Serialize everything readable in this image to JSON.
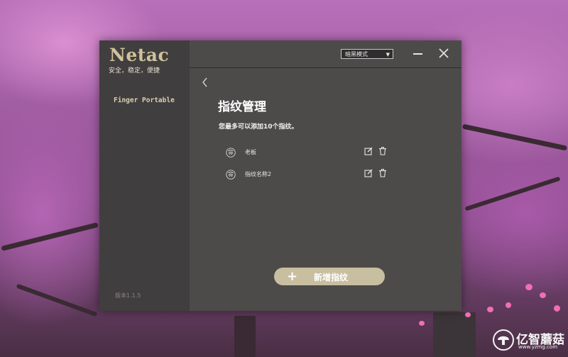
{
  "app": {
    "logo_text": "Netac",
    "slogan": "安全，稳定，便捷",
    "version": "版本1.1.5"
  },
  "sidebar": {
    "items": [
      {
        "label": "Finger Portable"
      }
    ]
  },
  "topbar": {
    "theme_select": {
      "value": "暗黑模式"
    }
  },
  "main": {
    "title": "指纹管理",
    "subtitle": "您最多可以添加10个指纹。",
    "fingerprints": [
      {
        "name": "老板"
      },
      {
        "name": "指纹名称2"
      }
    ],
    "add_button": {
      "label": "新增指纹",
      "icon": "plus-icon"
    }
  },
  "watermark": {
    "text": "亿智蘑菇",
    "url": "www.yzmg.com"
  },
  "colors": {
    "window_bg": "#4d4a4a",
    "sidebar_bg": "#403e3e",
    "accent": "#c8bea0",
    "logo": "#cfc29c"
  }
}
